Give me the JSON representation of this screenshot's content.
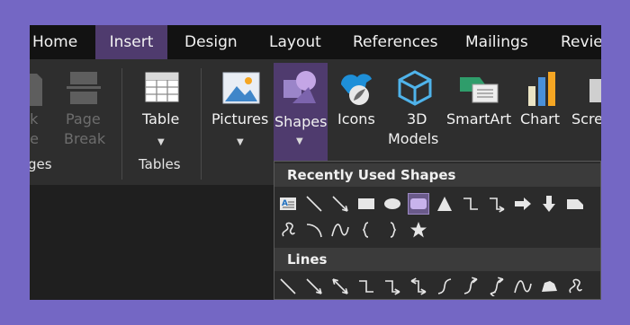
{
  "tabs": [
    {
      "label": "Home"
    },
    {
      "label": "Insert"
    },
    {
      "label": "Design"
    },
    {
      "label": "Layout"
    },
    {
      "label": "References"
    },
    {
      "label": "Mailings"
    },
    {
      "label": "Review"
    }
  ],
  "active_tab": "Insert",
  "ribbon": {
    "pages_group": {
      "blank_page_label_1": "nk",
      "blank_page_label_2": "ge",
      "page_break_label_1": "Page",
      "page_break_label_2": "Break",
      "group_label": "ges"
    },
    "tables_group": {
      "table_label": "Table",
      "group_label": "Tables"
    },
    "illustrations_group": {
      "pictures_label": "Pictures",
      "shapes_label": "Shapes",
      "icons_label": "Icons",
      "models_label_1": "3D",
      "models_label_2": "Models",
      "smartart_label": "SmartArt",
      "chart_label": "Chart",
      "screenshot_label": "Scre"
    }
  },
  "shapes_dropdown": {
    "recently_used_heading": "Recently Used Shapes",
    "lines_heading": "Lines",
    "recent_row1": [
      "text-box-icon",
      "line-icon",
      "arrow-line-icon",
      "rectangle-icon",
      "oval-icon",
      "rounded-rectangle-icon",
      "isosceles-triangle-icon",
      "elbow-connector-icon",
      "elbow-arrow-connector-icon",
      "right-arrow-icon",
      "down-arrow-icon",
      "snip-rectangle-icon"
    ],
    "recent_row2": [
      "freeform-scribble-icon",
      "arc-icon",
      "curve-icon",
      "left-brace-icon",
      "right-brace-icon",
      "star-icon"
    ],
    "lines_row": [
      "line-icon",
      "arrow-line-icon",
      "double-arrow-line-icon",
      "elbow-connector-icon",
      "elbow-arrow-connector-icon",
      "elbow-double-arrow-connector-icon",
      "curved-connector-icon",
      "curved-arrow-connector-icon",
      "curved-double-arrow-connector-icon",
      "curve-icon",
      "freeform-shape-icon",
      "freeform-scribble-icon"
    ]
  },
  "colors": {
    "accent": "#4f3b6e",
    "background": "#7467c4"
  }
}
